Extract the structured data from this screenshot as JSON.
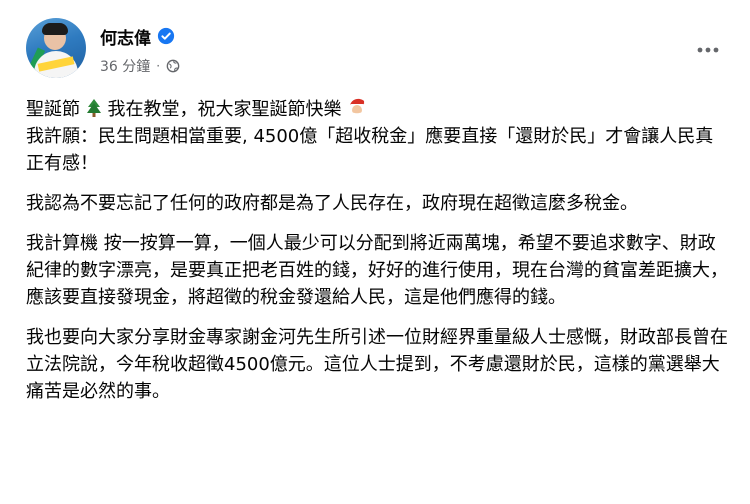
{
  "post": {
    "author": "何志偉",
    "time": "36 分鐘",
    "separator": "·",
    "icons": {
      "verified": "verified-badge-icon",
      "audience": "public-globe-icon",
      "more": "more-options-icon"
    },
    "accent_color": "#1877f2",
    "paragraphs": {
      "p1_a": "聖誕節",
      "p1_b": "我在教堂，祝大家聖誕節快樂",
      "p1_c": "我許願：民生問題相當重要, 4500億「超收稅金」應要直接「還財於民」才會讓人民真正有感！",
      "p2": "我認為不要忘記了任何的政府都是為了人民存在，政府現在超徵這麼多稅金。",
      "p3": "我計算機 按一按算一算，一個人最少可以分配到將近兩萬塊，希望不要追求數字、財政紀律的數字漂亮，是要真正把老百姓的錢，好好的進行使用，現在台灣的貧富差距擴大，應該要直接發現金，將超徵的稅金發還給人民，這是他們應得的錢。",
      "p4": "我也要向大家分享財金專家謝金河先生所引述一位財經界重量級人士感慨，財政部長曾在立法院說，今年稅收超徵4500億元。這位人士提到，不考慮還財於民，這樣的黨選舉大痛苦是必然的事。"
    }
  }
}
